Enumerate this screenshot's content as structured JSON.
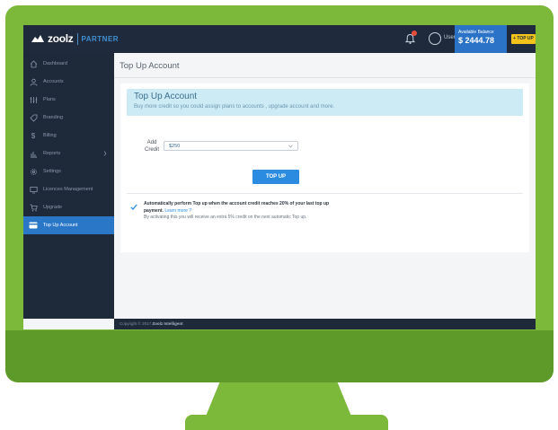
{
  "header": {
    "logo_text": "zoolz",
    "logo_partner": "PARTNER",
    "user_label": "User",
    "balance_caption": "Available Balance",
    "balance_value": "$ 2444.78",
    "topup_chip": "+ TOP UP"
  },
  "sidebar": {
    "items": [
      {
        "label": "Dashboard",
        "icon": "home-icon"
      },
      {
        "label": "Accounts",
        "icon": "users-icon"
      },
      {
        "label": "Plans",
        "icon": "plans-icon"
      },
      {
        "label": "Branding",
        "icon": "tag-icon"
      },
      {
        "label": "Billing",
        "icon": "dollar-icon"
      },
      {
        "label": "Reports",
        "icon": "chart-icon"
      },
      {
        "label": "Settings",
        "icon": "gear-icon"
      },
      {
        "label": "Licences Management",
        "icon": "monitor-icon"
      },
      {
        "label": "Upgrade",
        "icon": "cart-icon"
      },
      {
        "label": "Top Up Account",
        "icon": "card-icon"
      }
    ],
    "active_index": 9
  },
  "main": {
    "page_title": "Top Up Account",
    "banner_title": "Top Up Account",
    "banner_subtitle": "Buy more credit so you could assign plans to accounts , upgrade account and more.",
    "add_credit_label": "Add Credit",
    "credit_value": "$250",
    "topup_button": "TOP UP",
    "auto_topup_bold": "Automatically perform Top up when the account credit reaches 20% of your last top up payment.",
    "auto_topup_link": "Learn more ?",
    "auto_topup_note": "By activating this you will receive an extra 5% credit on the next automatic Top up."
  },
  "footer": {
    "copyright": "Copyright © 2017",
    "brand": "Zoolz Intelligent"
  },
  "colors": {
    "monitor_green": "#7cb83a",
    "topbar": "#1f2b3d",
    "accent_blue": "#2a77c8",
    "chip_yellow": "#f2c31a",
    "banner_cyan": "#cdebf5"
  }
}
